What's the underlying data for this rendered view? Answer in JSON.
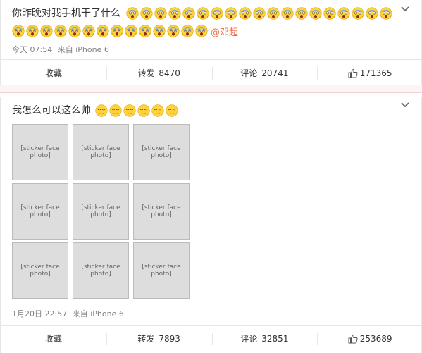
{
  "posts": [
    {
      "text": "你昨晚对我手机干了什么",
      "mention": "@邓超",
      "time": "今天 07:54",
      "source": "来自 iPhone 6",
      "actions": {
        "favorite": "收藏",
        "repost_label": "转发",
        "repost_count": "8470",
        "comment_label": "评论",
        "comment_count": "20741",
        "like_count": "171365"
      },
      "emoji_icon": "shocked-face-emoji",
      "emoji_count": 33
    },
    {
      "text": "我怎么可以这么帅",
      "time": "1月20日 22:57",
      "source": "来自 iPhone 6",
      "actions": {
        "favorite": "收藏",
        "repost_label": "转发",
        "repost_count": "7893",
        "comment_label": "评论",
        "comment_count": "32851",
        "like_count": "253689"
      },
      "emoji_icon": "smug-face-emoji",
      "emoji_count": 6,
      "photo_count": 9
    }
  ],
  "colors": {
    "mention": "#eb7350",
    "meta": "#808080",
    "divider_bg": "#fdf4f5"
  }
}
